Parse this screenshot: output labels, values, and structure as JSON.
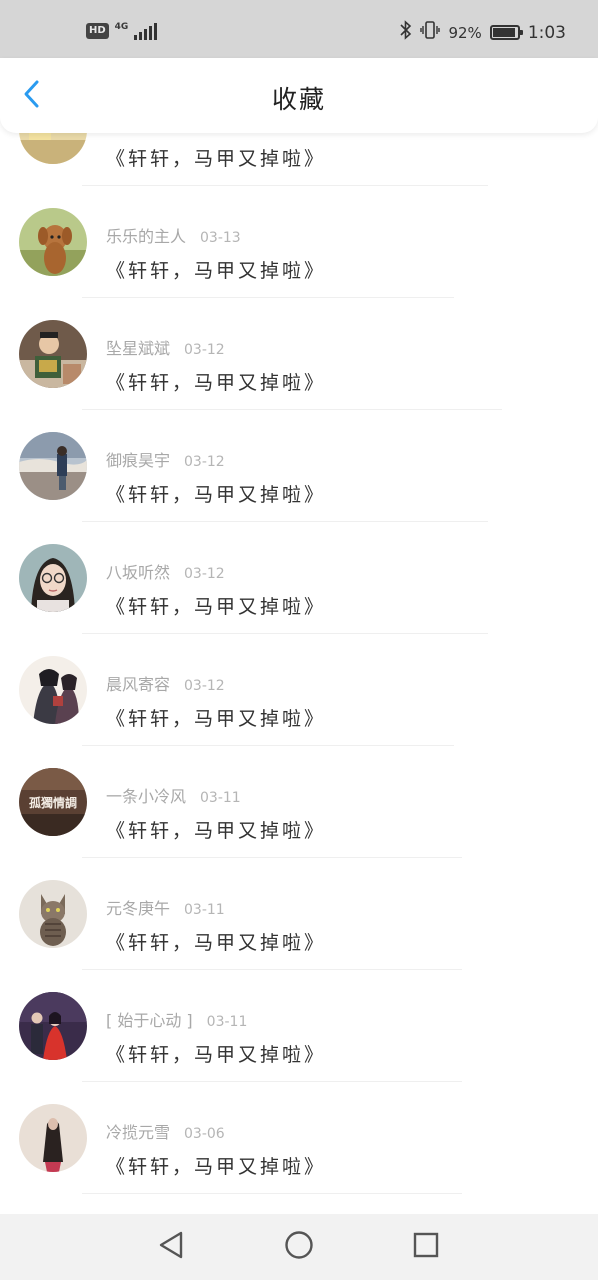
{
  "status_bar": {
    "hd_label": "HD",
    "network_type": "4G",
    "battery_percent_text": "92%",
    "battery_level": 0.92,
    "time": "1:03"
  },
  "header": {
    "title": "收藏",
    "back_icon": "chevron-left-icon"
  },
  "colors": {
    "accent": "#2a9bf0",
    "status_bar_bg": "#d6d6d6",
    "username_text": "#a8a8a8",
    "title_text": "#333333"
  },
  "favorites": [
    {
      "username": "",
      "date": "",
      "title": "《轩轩，马甲又掉啦》",
      "avatar": "partial-avatar"
    },
    {
      "username": "乐乐的主人",
      "date": "03-13",
      "title": "《轩轩，马甲又掉啦》",
      "avatar": "poodle-avatar"
    },
    {
      "username": "坠星斌斌",
      "date": "03-12",
      "title": "《轩轩，马甲又掉啦》",
      "avatar": "toy-figure-avatar"
    },
    {
      "username": "御痕昊宇",
      "date": "03-12",
      "title": "《轩轩，马甲又掉啦》",
      "avatar": "seaside-avatar"
    },
    {
      "username": "八坂听然",
      "date": "03-12",
      "title": "《轩轩，马甲又掉啦》",
      "avatar": "girl-glasses-avatar"
    },
    {
      "username": "晨风寄容",
      "date": "03-12",
      "title": "《轩轩，马甲又掉啦》",
      "avatar": "anime-couple-avatar"
    },
    {
      "username": "一条小冷风",
      "date": "03-11",
      "title": "《轩轩，马甲又掉啦》",
      "avatar": "text-badge-avatar",
      "avatar_text": "孤獨情調"
    },
    {
      "username": "元冬庚午",
      "date": "03-11",
      "title": "《轩轩，马甲又掉啦》",
      "avatar": "cat-avatar"
    },
    {
      "username": "[ 始于心动 ]",
      "date": "03-11",
      "title": "《轩轩，马甲又掉啦》",
      "avatar": "couple-avatar"
    },
    {
      "username": "冷揽元雪",
      "date": "03-06",
      "title": "《轩轩，马甲又掉啦》",
      "avatar": "long-hair-avatar"
    }
  ],
  "nav_bar": {
    "back_icon": "triangle-back-icon",
    "home_icon": "circle-home-icon",
    "recents_icon": "square-recents-icon"
  }
}
